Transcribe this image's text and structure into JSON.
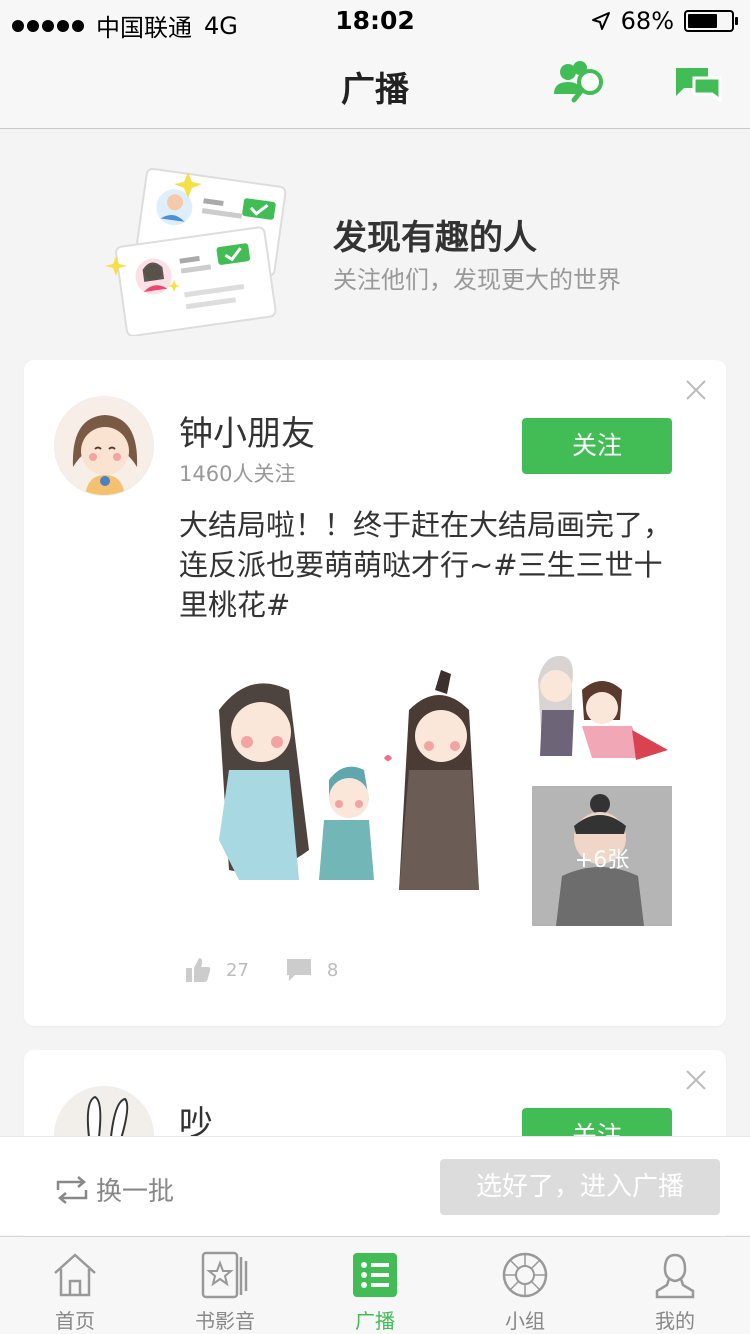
{
  "status_bar": {
    "carrier": "中国联通",
    "network": "4G",
    "time": "18:02",
    "battery_percent": "68%",
    "battery_level": 0.68
  },
  "navbar": {
    "title": "广播",
    "icons": [
      "find-people-icon",
      "chat-icon"
    ]
  },
  "discover": {
    "title": "发现有趣的人",
    "subtitle": "关注他们，发现更大的世界"
  },
  "cards": [
    {
      "name": "钟小朋友",
      "followers": "1460人关注",
      "follow_label": "关注",
      "post_text": "大结局啦！！终于赶在大结局画完了，连反派也要萌萌哒才行~#三生三世十里桃花#",
      "more_images": "+6张",
      "likes": "27",
      "comments": "8"
    },
    {
      "name": "吵",
      "follow_label": "关注"
    }
  ],
  "action_bar": {
    "shuffle_label": "换一批",
    "enter_label": "选好了，进入广播"
  },
  "tabs": [
    {
      "label": "首页",
      "icon": "home-icon"
    },
    {
      "label": "书影音",
      "icon": "books-movies-icon"
    },
    {
      "label": "广播",
      "icon": "broadcast-icon",
      "active": true
    },
    {
      "label": "小组",
      "icon": "group-icon"
    },
    {
      "label": "我的",
      "icon": "profile-icon"
    }
  ],
  "colors": {
    "accent": "#42bd56",
    "disabled": "#dcdcdc",
    "muted_text": "#999999"
  }
}
